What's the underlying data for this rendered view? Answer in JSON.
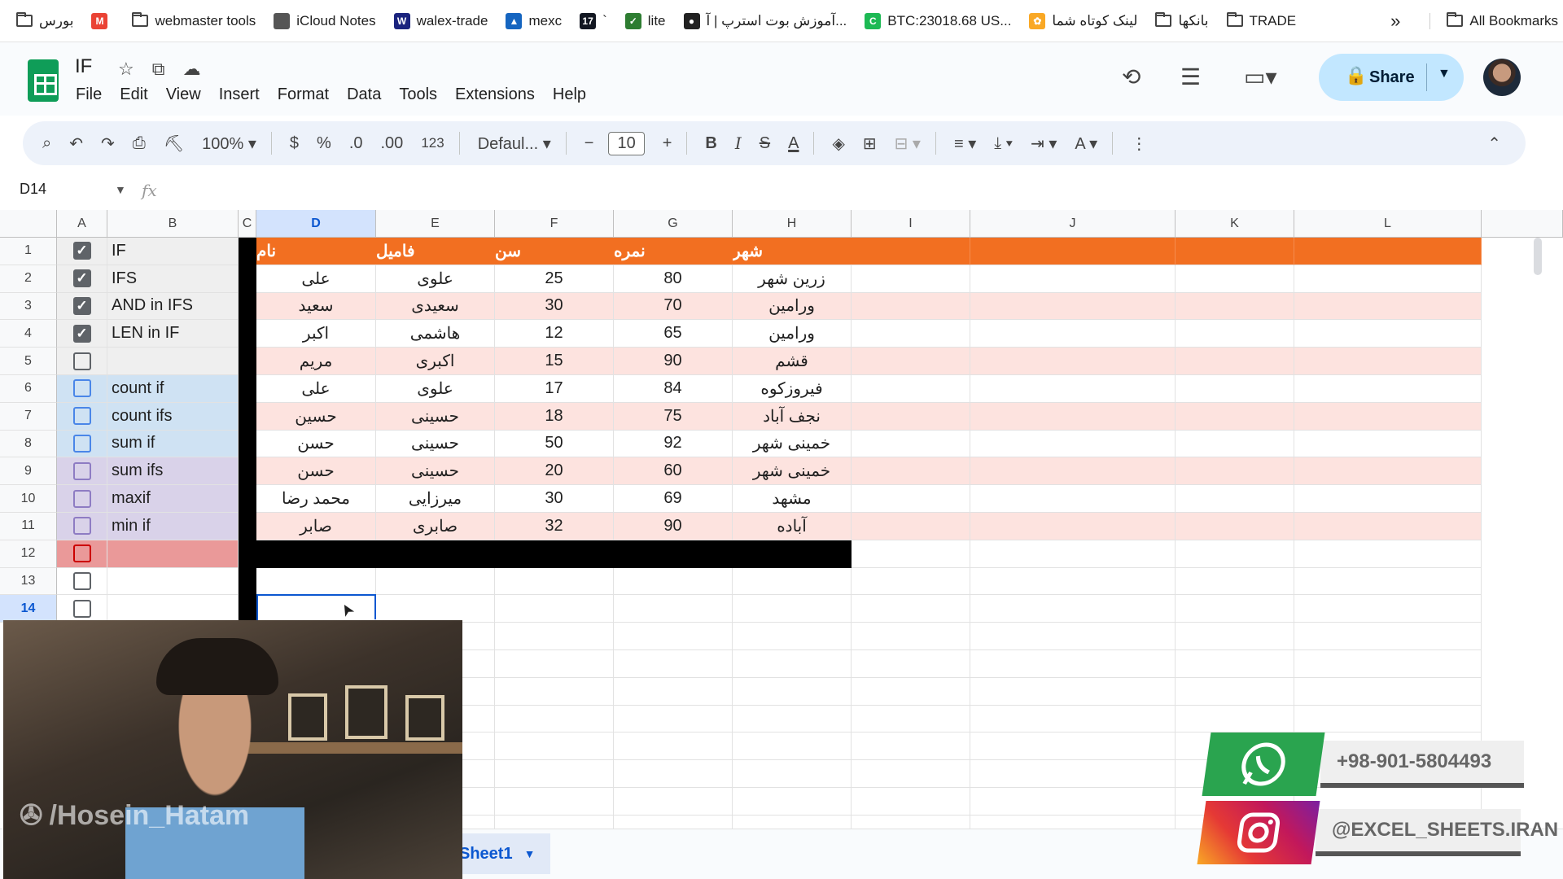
{
  "bookmarks": {
    "items": [
      {
        "label": "بورس",
        "icon": "folder-icon"
      },
      {
        "label": "",
        "icon": "gmail-icon"
      },
      {
        "label": "webmaster tools",
        "icon": "folder-icon"
      },
      {
        "label": "iCloud Notes",
        "icon": "apple-icon"
      },
      {
        "label": "walex-trade",
        "icon": "walex-icon"
      },
      {
        "label": "mexc",
        "icon": "mexc-icon"
      },
      {
        "label": "`",
        "icon": "tradingview-icon"
      },
      {
        "label": "lite",
        "icon": "lite-icon"
      },
      {
        "label": "آموزش بوت استرپ | آ...",
        "icon": "globe-icon"
      },
      {
        "label": "BTC:23018.68 US...",
        "icon": "btc-icon"
      },
      {
        "label": "لینک کوتاه شما",
        "icon": "link-icon"
      },
      {
        "label": "بانکها",
        "icon": "folder-icon"
      },
      {
        "label": "TRADE",
        "icon": "folder-icon"
      }
    ],
    "overflow": "»",
    "all_bookmarks": "All Bookmarks"
  },
  "app": {
    "title": "IF",
    "menu": [
      "File",
      "Edit",
      "View",
      "Insert",
      "Format",
      "Data",
      "Tools",
      "Extensions",
      "Help"
    ],
    "share_label": "Share"
  },
  "toolbar": {
    "zoom": "100%",
    "currency": "$",
    "percent": "%",
    "dec_decrease": ".0",
    "dec_increase": ".00",
    "format_123": "123",
    "font": "Defaul...",
    "font_size": "10",
    "bold": "B",
    "italic": "I",
    "strike": "S",
    "text_color": "A"
  },
  "formula_bar": {
    "name_box": "D14",
    "fx": "fx"
  },
  "columns": [
    "A",
    "B",
    "C",
    "D",
    "E",
    "F",
    "G",
    "H",
    "I",
    "J",
    "K",
    "L"
  ],
  "selected_column": "D",
  "rows": [
    "1",
    "2",
    "3",
    "4",
    "5",
    "6",
    "7",
    "8",
    "9",
    "10",
    "11",
    "12",
    "13",
    "14"
  ],
  "selected_row": "14",
  "checklist": [
    {
      "checked": true,
      "label": "IF"
    },
    {
      "checked": true,
      "label": "IFS"
    },
    {
      "checked": true,
      "label": "AND in IFS"
    },
    {
      "checked": true,
      "label": "LEN in IF"
    },
    {
      "checked": false,
      "label": ""
    },
    {
      "checked": false,
      "label": "count if"
    },
    {
      "checked": false,
      "label": "count ifs"
    },
    {
      "checked": false,
      "label": "sum if"
    },
    {
      "checked": false,
      "label": "sum ifs"
    },
    {
      "checked": false,
      "label": "maxif"
    },
    {
      "checked": false,
      "label": "min if"
    },
    {
      "checked": false,
      "label": ""
    },
    {
      "checked": false,
      "label": ""
    },
    {
      "checked": false,
      "label": ""
    }
  ],
  "table": {
    "headers": [
      "نام",
      "فامیل",
      "سن",
      "نمره",
      "شهر"
    ],
    "rows": [
      [
        "علی",
        "علوی",
        "25",
        "80",
        "زرین شهر"
      ],
      [
        "سعید",
        "سعیدی",
        "30",
        "70",
        "ورامین"
      ],
      [
        "اکبر",
        "هاشمی",
        "12",
        "65",
        "ورامین"
      ],
      [
        "مریم",
        "اکبری",
        "15",
        "90",
        "قشم"
      ],
      [
        "علی",
        "علوی",
        "17",
        "84",
        "فیروزکوه"
      ],
      [
        "حسین",
        "حسینی",
        "18",
        "75",
        "نجف آباد"
      ],
      [
        "حسن",
        "حسینی",
        "50",
        "92",
        "خمینی شهر"
      ],
      [
        "حسن",
        "حسینی",
        "20",
        "60",
        "خمینی شهر"
      ],
      [
        "محمد رضا",
        "میرزایی",
        "30",
        "69",
        "مشهد"
      ],
      [
        "صابر",
        "صابری",
        "32",
        "90",
        "آباده"
      ]
    ]
  },
  "colors": {
    "header_orange": "#f26f21",
    "band_pink": "#fde3df",
    "blue_band": "#cfe2f3",
    "purple_band": "#d9d2e9",
    "red_band": "#ea9999",
    "checkbox_blue": "#4a86e8",
    "checkbox_purple": "#8e7cc3",
    "checkbox_red": "#cc0000"
  },
  "sheet_tab": "Sheet1",
  "overlay": {
    "watermark": "/Hosein_Hatam",
    "whatsapp": "+98-901-5804493",
    "instagram": "@EXCEL_SHEETS.IRAN"
  }
}
